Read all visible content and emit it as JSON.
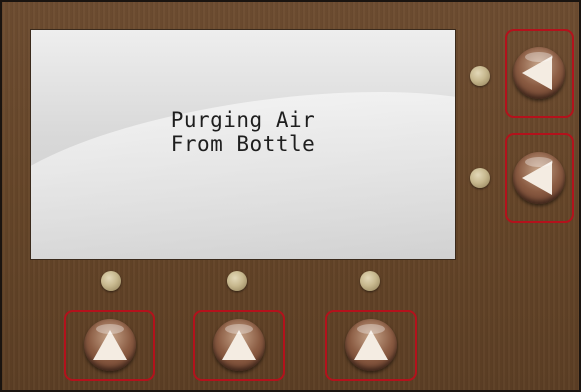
{
  "display": {
    "line1": "Purging Air",
    "line2": "From Bottle"
  },
  "side_buttons": [
    {
      "name": "side-soft-key-1",
      "icon": "arrow-left-icon"
    },
    {
      "name": "side-soft-key-2",
      "icon": "arrow-left-icon"
    }
  ],
  "bottom_buttons": [
    {
      "name": "bottom-soft-key-1",
      "icon": "arrow-up-icon"
    },
    {
      "name": "bottom-soft-key-2",
      "icon": "arrow-up-icon"
    },
    {
      "name": "bottom-soft-key-3",
      "icon": "arrow-up-icon"
    }
  ],
  "colors": {
    "panel": "#664629",
    "button_frame": "#b3121c",
    "screen": "#d9d9d9",
    "indicator": "#c7b88e"
  }
}
